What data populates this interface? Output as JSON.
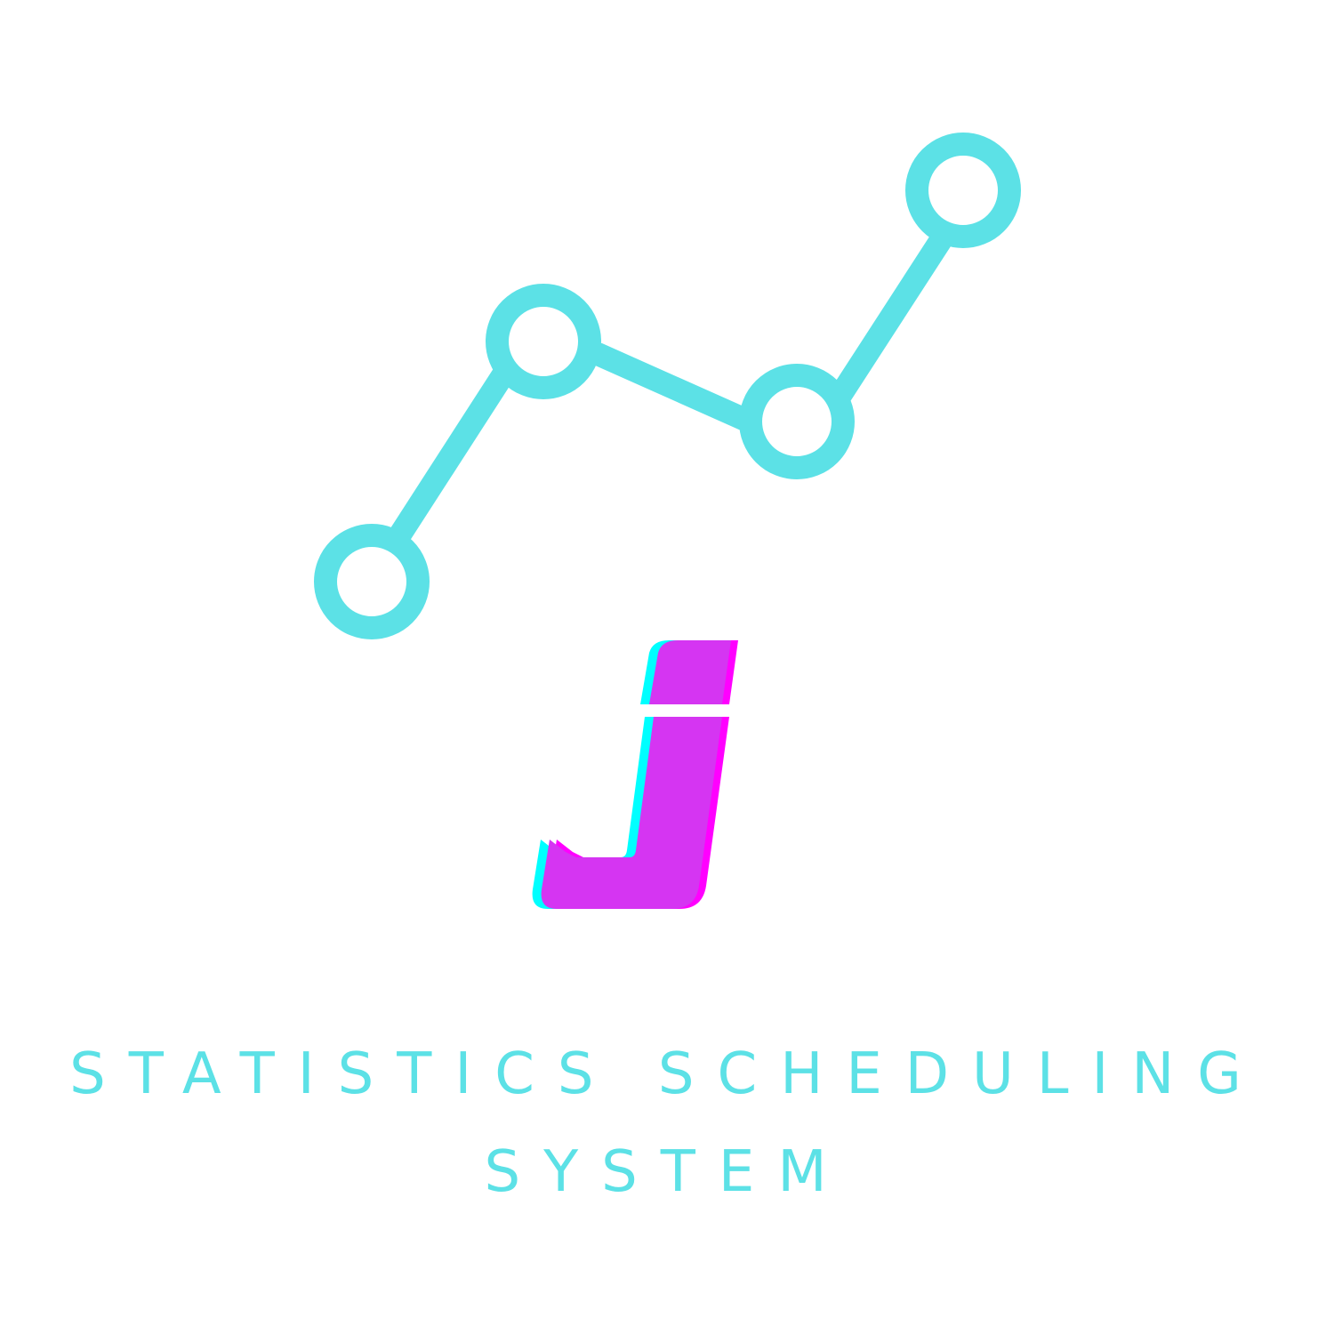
{
  "logo": {
    "letter": "j",
    "primary_color": "#5ce1e6",
    "letter_color": "#d535f2",
    "letter_shadow_magenta": "#ff00ff",
    "letter_shadow_cyan": "#00ffff",
    "icon_name": "line-chart-icon"
  },
  "title": {
    "line1": "STATISTICS SCHEDULING",
    "line2": "SYSTEM"
  }
}
